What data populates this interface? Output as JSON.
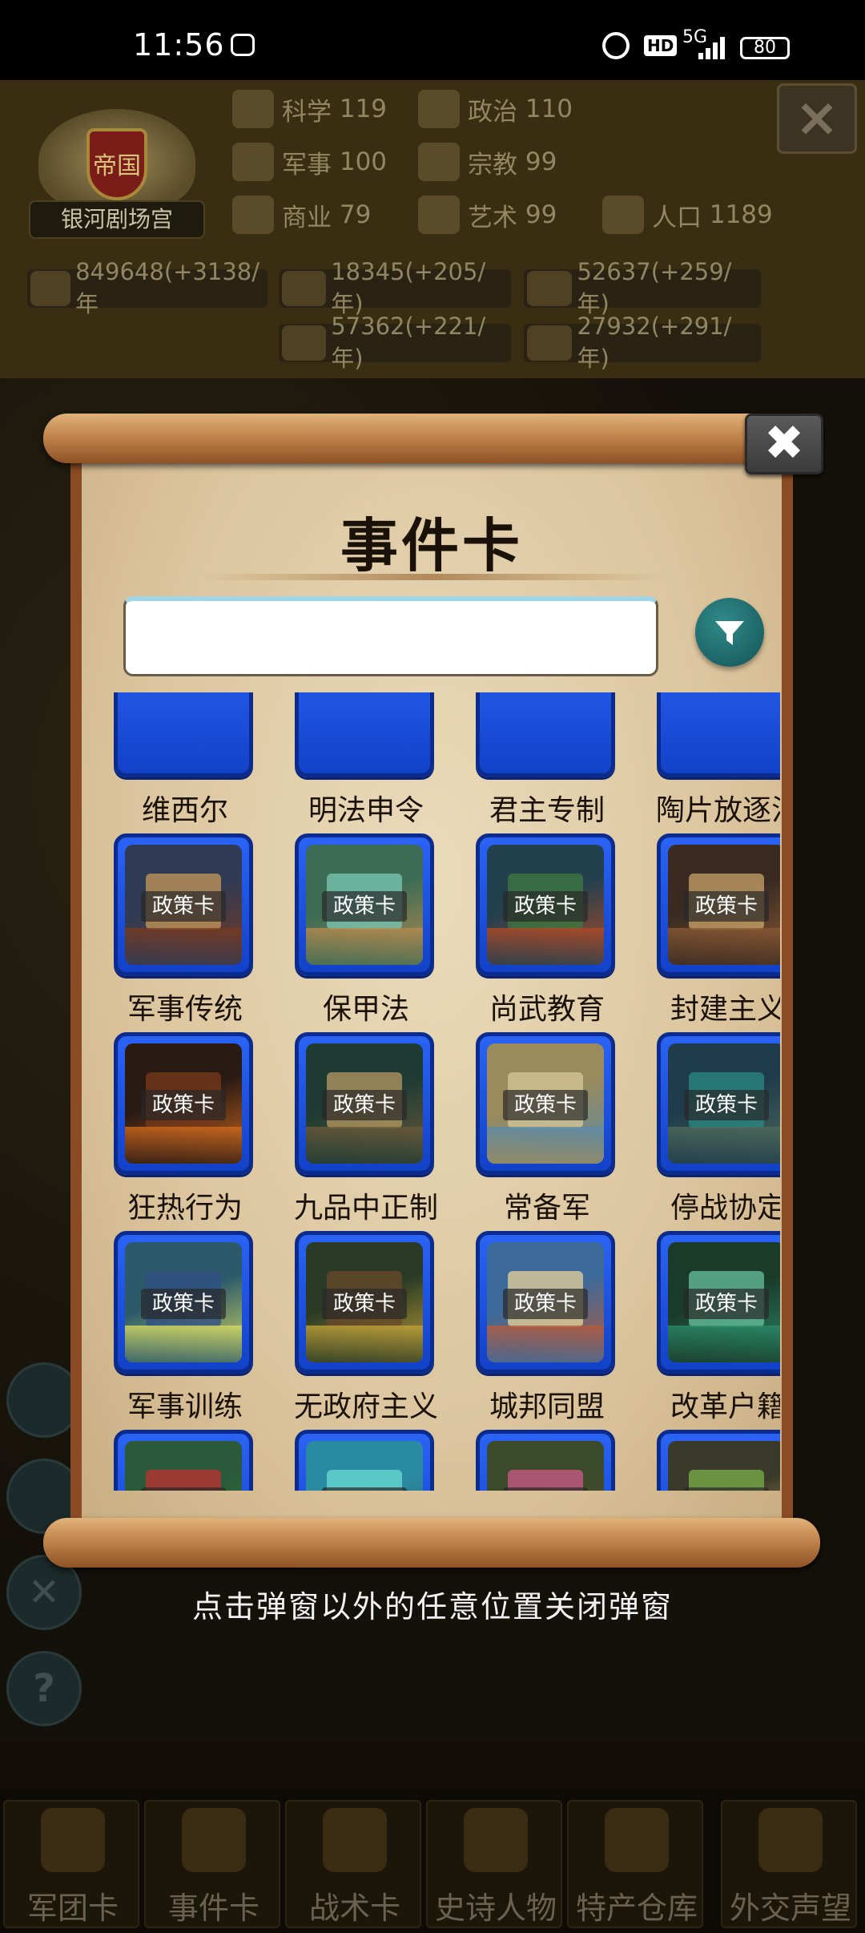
{
  "status_bar": {
    "time": "11:56",
    "hd": "HD",
    "signal_label": "5G",
    "battery": "80"
  },
  "empire": {
    "emblem_text": "帝国",
    "capital_name": "银河剧场宫"
  },
  "stats": [
    {
      "label": "科学",
      "value": "119",
      "icon": "planet-icon"
    },
    {
      "label": "政治",
      "value": "110",
      "icon": "bank-icon"
    },
    {
      "label": "军事",
      "value": "100",
      "icon": "crossed-swords-icon"
    },
    {
      "label": "宗教",
      "value": "99",
      "icon": "cross-icon"
    },
    {
      "label": "商业",
      "value": "79",
      "icon": "scales-icon"
    },
    {
      "label": "艺术",
      "value": "99",
      "icon": "lotus-icon"
    },
    {
      "label": "人口",
      "value": "1189",
      "icon": "person-icon"
    }
  ],
  "resources": [
    {
      "value": "849648(+3138/年",
      "icon": "gold-coins-icon"
    },
    {
      "value": "18345(+205/年)",
      "icon": "wood-logs-icon"
    },
    {
      "value": "52637(+259/年)",
      "icon": "feather-icon"
    },
    {
      "value": "57362(+221/年)",
      "icon": "iron-icon"
    },
    {
      "value": "27932(+291/年)",
      "icon": "meat-icon"
    }
  ],
  "modal": {
    "title": "事件卡",
    "search_placeholder": "",
    "search_value": "",
    "close_symbol": "✖",
    "card_tag": "政策卡",
    "partial_row": [
      "维西尔",
      "明法申令",
      "君主专制",
      "陶片放逐法"
    ],
    "cards": [
      {
        "name": "军事传统",
        "palette": [
          "#2f3a55",
          "#7a3a1f",
          "#c79a5a"
        ]
      },
      {
        "name": "保甲法",
        "palette": [
          "#3c6c55",
          "#b88a4e",
          "#7bc9b6"
        ]
      },
      {
        "name": "尚武教育",
        "palette": [
          "#23404f",
          "#b24a25",
          "#3d7a3f"
        ]
      },
      {
        "name": "封建主义",
        "palette": [
          "#3a2a22",
          "#8a5a34",
          "#c9a46a"
        ]
      },
      {
        "name": "狂热行为",
        "palette": [
          "#2a1a14",
          "#d06a1e",
          "#7a3a1a"
        ]
      },
      {
        "name": "九品中正制",
        "palette": [
          "#1e3b34",
          "#6b5a3a",
          "#b89a62"
        ]
      },
      {
        "name": "常备军",
        "palette": [
          "#9a8a5c",
          "#5a8aa8",
          "#d8c89a"
        ]
      },
      {
        "name": "停战协定",
        "palette": [
          "#1f3c4c",
          "#4f6b5a",
          "#2a8a86"
        ]
      },
      {
        "name": "军事训练",
        "palette": [
          "#2c5a6a",
          "#d8dc62",
          "#2f4f86"
        ]
      },
      {
        "name": "无政府主义",
        "palette": [
          "#2a3a24",
          "#c2a23a",
          "#6a4a2a"
        ]
      },
      {
        "name": "城邦同盟",
        "palette": [
          "#3c6a9a",
          "#b85a3a",
          "#e8d49a"
        ]
      },
      {
        "name": "改革户籍",
        "palette": [
          "#1a3a2a",
          "#2a8a6a",
          "#6ac2a2"
        ]
      },
      {
        "name": "",
        "palette": [
          "#2a5a3a",
          "#3a7a3a",
          "#c23030"
        ]
      },
      {
        "name": "",
        "palette": [
          "#2a8aa2",
          "#3a5a6a",
          "#6adcd2"
        ]
      },
      {
        "name": "",
        "palette": [
          "#3a4a2a",
          "#6a4a2a",
          "#d05a8a"
        ]
      },
      {
        "name": "",
        "palette": [
          "#3a3a2a",
          "#c2a25a",
          "#7ab24a"
        ]
      }
    ]
  },
  "hint": "点击弹窗以外的任意位置关闭弹窗",
  "bottom_nav": [
    "军团卡",
    "事件卡",
    "战术卡",
    "史诗人物",
    "特产仓库",
    "外交声望"
  ]
}
